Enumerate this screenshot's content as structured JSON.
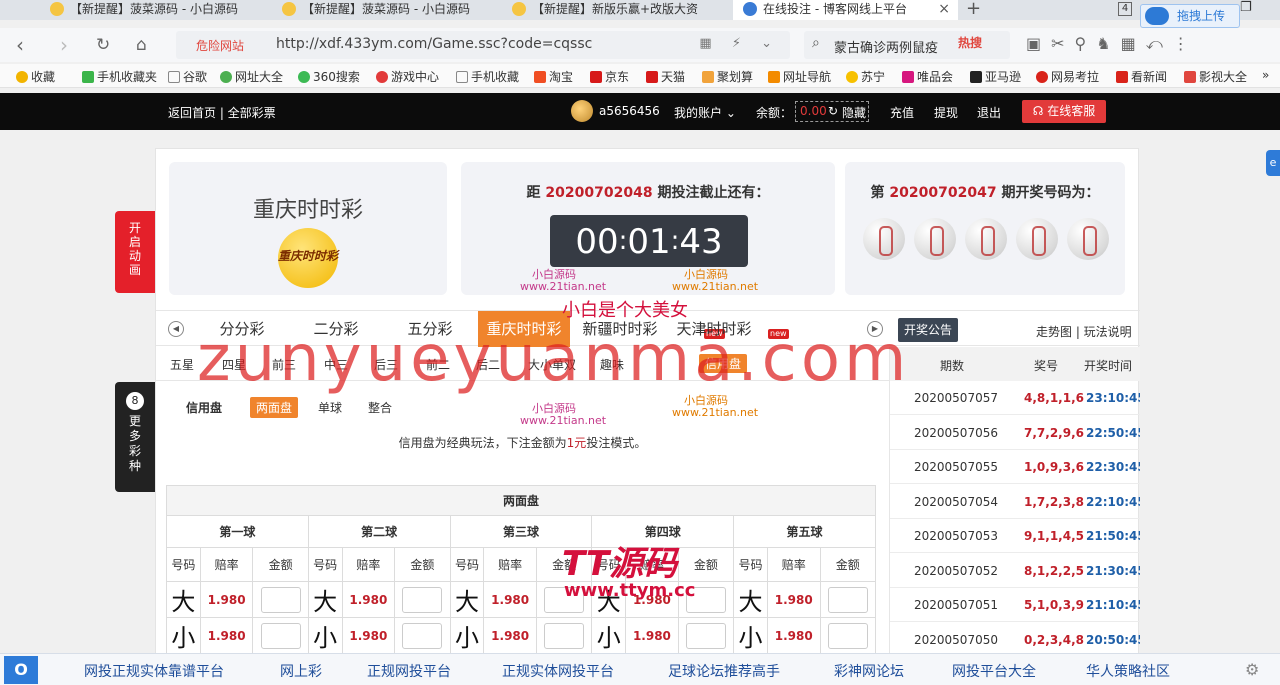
{
  "browser": {
    "tabs": [
      {
        "title": "【新提醒】菠菜源码 - 小白源码",
        "active": false
      },
      {
        "title": "【新提醒】菠菜源码 - 小白源码",
        "active": false
      },
      {
        "title": "【新提醒】新版乐赢+改版大资",
        "active": false
      },
      {
        "title": "在线投注 - 博客网线上平台",
        "active": true
      }
    ],
    "tab_count": "4",
    "upload_label": "拖拽上传",
    "url_warning": "危险网站",
    "url": "http://xdf.433ym.com/Game.ssc?code=cqssc",
    "search_text": "蒙古确诊两例鼠疫",
    "hot_label": "热搜",
    "bookmarks": [
      "收藏",
      "手机收藏夹",
      "谷歌",
      "网址大全",
      "360搜索",
      "游戏中心",
      "手机收藏",
      "淘宝",
      "京东",
      "天猫",
      "聚划算",
      "网址导航",
      "苏宁",
      "唯品会",
      "亚马逊",
      "网易考拉",
      "看新闻",
      "影视大全"
    ],
    "bookmark_more": "»"
  },
  "site": {
    "home_link": "返回首页 | 全部彩票",
    "username": "a5656456",
    "my_account": "我的账户",
    "balance_label": "余额：",
    "balance_value": "0.00",
    "hide_label": "隐藏",
    "recharge": "充值",
    "withdraw": "提现",
    "logout": "退出",
    "online_service": "在线客服"
  },
  "game": {
    "name": "重庆时时彩",
    "logo_text": "重庆时时彩",
    "countdown_prefix": "距",
    "current_issue": "20200702048",
    "countdown_suffix": "期投注截止还有：",
    "countdown": {
      "h": "00",
      "m": "01",
      "s": "43"
    },
    "last_prefix": "第",
    "last_issue": "20200702047",
    "last_suffix": "期开奖号码为："
  },
  "side": {
    "animation": "开启动画",
    "more_count": "8",
    "more": "更多彩种"
  },
  "game_tabs": [
    {
      "label": "分分彩",
      "active": false
    },
    {
      "label": "二分彩",
      "active": false
    },
    {
      "label": "五分彩",
      "active": false
    },
    {
      "label": "重庆时时彩",
      "active": true
    },
    {
      "label": "新疆时时彩",
      "active": false,
      "badge": "new"
    },
    {
      "label": "天津时时彩",
      "active": false,
      "badge": "new"
    }
  ],
  "announce": "开奖公告",
  "chart_link": "走势图 | 玩法说明",
  "play_tabs": [
    "五星",
    "四星",
    "前三",
    "中三",
    "后三",
    "前二",
    "后二",
    "大小单双",
    "趣味",
    "信用盘"
  ],
  "active_play_tab": "信用盘",
  "modes": {
    "label": "信用盘",
    "items": [
      "两面盘",
      "单球",
      "整合"
    ],
    "active": "两面盘",
    "note_before": "信用盘为经典玩法，下注金额为",
    "note_amount": "1元",
    "note_after": "投注模式。"
  },
  "bet_table": {
    "title": "两面盘",
    "balls": [
      "第一球",
      "第二球",
      "第三球",
      "第四球",
      "第五球"
    ],
    "col_headers": [
      "号码",
      "赔率",
      "金额"
    ],
    "rows": [
      {
        "label": "大",
        "odds": "1.980"
      },
      {
        "label": "小",
        "odds": "1.980"
      }
    ]
  },
  "history": {
    "headers": [
      "期数",
      "奖号",
      "开奖时间"
    ],
    "rows": [
      {
        "issue": "20200507057",
        "numbers": "4,8,1,1,6",
        "time": "23:10:45"
      },
      {
        "issue": "20200507056",
        "numbers": "7,7,2,9,6",
        "time": "22:50:45"
      },
      {
        "issue": "20200507055",
        "numbers": "1,0,9,3,6",
        "time": "22:30:45"
      },
      {
        "issue": "20200507054",
        "numbers": "1,7,2,3,8",
        "time": "22:10:45"
      },
      {
        "issue": "20200507053",
        "numbers": "9,1,1,4,5",
        "time": "21:50:45"
      },
      {
        "issue": "20200507052",
        "numbers": "8,1,2,2,5",
        "time": "21:30:45"
      },
      {
        "issue": "20200507051",
        "numbers": "5,1,0,3,9",
        "time": "21:10:45"
      },
      {
        "issue": "20200507050",
        "numbers": "0,2,3,4,8",
        "time": "20:50:45"
      }
    ]
  },
  "watermarks": {
    "big": "zunyueyuanma.com",
    "cn": "小白是个大美女",
    "small_a": "小白源码",
    "small_a_url": "www.21tian.net",
    "tt": "TT源码",
    "tt_url": "www.ttym.cc"
  },
  "bottom_links": [
    "网投正规实体靠谱平台",
    "网上彩",
    "正规网投平台",
    "正规实体网投平台",
    "足球论坛推荐高手",
    "彩神网论坛",
    "网投平台大全",
    "华人策略社区"
  ],
  "colors": {
    "accent": "#f0842c",
    "danger": "#e4202a",
    "header_bg": "#0c0c0c",
    "link": "#1f5fa8"
  }
}
